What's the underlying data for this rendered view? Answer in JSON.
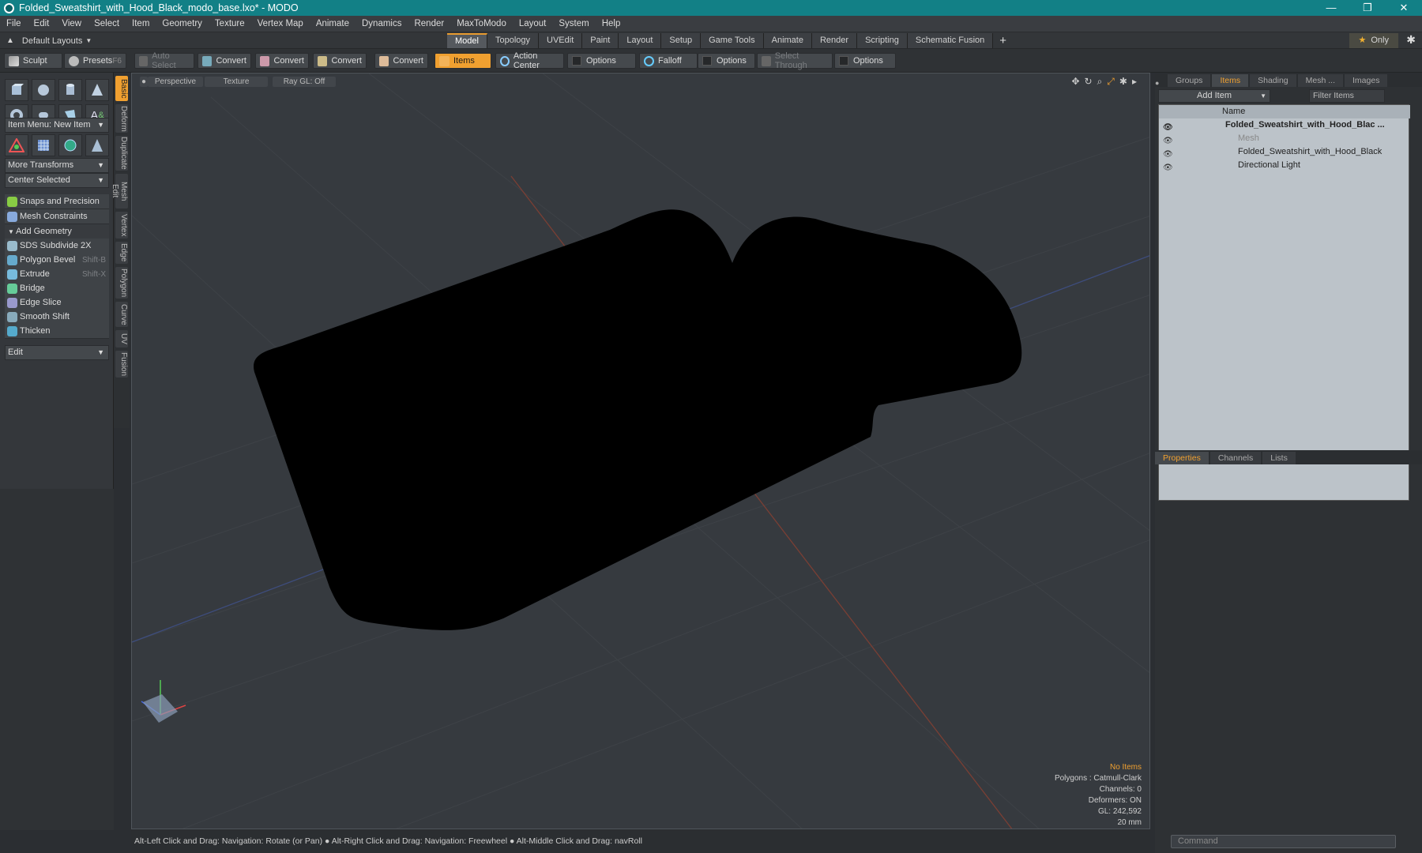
{
  "window": {
    "title": "Folded_Sweatshirt_with_Hood_Black_modo_base.lxo* - MODO",
    "min": "—",
    "max": "❐",
    "close": "✕"
  },
  "menu": [
    "File",
    "Edit",
    "View",
    "Select",
    "Item",
    "Geometry",
    "Texture",
    "Vertex Map",
    "Animate",
    "Dynamics",
    "Render",
    "MaxToModo",
    "Layout",
    "System",
    "Help"
  ],
  "layouts": {
    "label": "Default Layouts",
    "tabs": [
      "Model",
      "Topology",
      "UVEdit",
      "Paint",
      "Layout",
      "Setup",
      "Game Tools",
      "Animate",
      "Render",
      "Scripting",
      "Schematic Fusion"
    ],
    "active": "Model",
    "only": "Only"
  },
  "toolbar": {
    "sculpt": "Sculpt",
    "presets": "Presets",
    "presets_key": "F6",
    "auto_select": "Auto Select",
    "convert": "Convert",
    "items": "Items",
    "action_center": "Action Center",
    "options": "Options",
    "falloff": "Falloff",
    "select_through": "Select Through"
  },
  "left": {
    "item_menu": "Item Menu: New Item",
    "more_transforms": "More Transforms",
    "center_selected": "Center Selected",
    "snaps": "Snaps and Precision",
    "constraints": "Mesh Constraints",
    "add_geometry": "Add Geometry",
    "edit": "Edit",
    "tools": [
      {
        "label": "SDS Subdivide 2X",
        "key": ""
      },
      {
        "label": "Polygon Bevel",
        "key": "Shift-B"
      },
      {
        "label": "Extrude",
        "key": "Shift-X"
      },
      {
        "label": "Bridge",
        "key": ""
      },
      {
        "label": "Edge Slice",
        "key": ""
      },
      {
        "label": "Smooth Shift",
        "key": ""
      },
      {
        "label": "Thicken",
        "key": ""
      }
    ]
  },
  "vtabs": [
    "Basic",
    "Deform",
    "Duplicate",
    "Mesh Edit",
    "Vertex",
    "Edge",
    "Polygon",
    "Curve",
    "UV",
    "Fusion"
  ],
  "viewport": {
    "view": "Perspective",
    "shading": "Texture",
    "raygl": "Ray GL: Off",
    "info": {
      "no_items": "No Items",
      "polygons": "Polygons : Catmull-Clark",
      "channels": "Channels: 0",
      "deformers": "Deformers: ON",
      "gl": "GL: 242,592",
      "scale": "20 mm"
    }
  },
  "status": "Alt-Left Click and Drag: Navigation: Rotate (or Pan) ● Alt-Right Click and Drag: Navigation: Freewheel ● Alt-Middle Click and Drag: navRoll",
  "right": {
    "tabs": [
      "Groups",
      "Items",
      "Shading",
      "Mesh ...",
      "Images"
    ],
    "active_tab": "Items",
    "add_item": "Add Item",
    "filter": "Filter Items",
    "col_name": "Name",
    "items": [
      {
        "label": "Folded_Sweatshirt_with_Hood_Blac ..."
      },
      {
        "label": "Mesh"
      },
      {
        "label": "Folded_Sweatshirt_with_Hood_Black"
      },
      {
        "label": "Directional Light"
      }
    ],
    "props_tabs": [
      "Properties",
      "Channels",
      "Lists"
    ],
    "props_active": "Properties",
    "command": "Command"
  },
  "colors": {
    "accent": "#f0a030",
    "titlebar": "#128086"
  }
}
